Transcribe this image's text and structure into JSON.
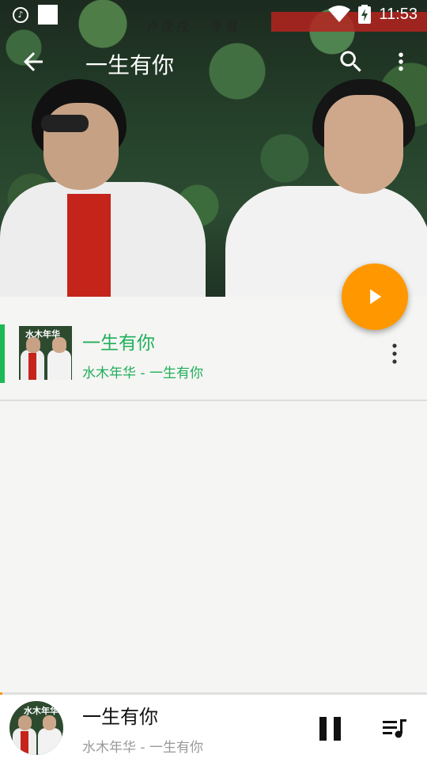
{
  "status_bar": {
    "time": "11:53",
    "icons": [
      "music-note-icon",
      "notification-square-icon",
      "wifi-icon",
      "battery-charging-icon"
    ]
  },
  "toolbar": {
    "title": "一生有你",
    "back_icon": "arrow-left-icon",
    "search_icon": "search-icon",
    "more_icon": "more-vertical-icon"
  },
  "album_art": {
    "text_line": "卢庚戌 · 李健",
    "banner_text": "一生有 你"
  },
  "fab": {
    "icon": "play-icon",
    "color": "#ff9800"
  },
  "song_list": [
    {
      "title": "一生有你",
      "subtitle": "水木年华 - 一生有你",
      "thumb_text": "水木年华",
      "active": true
    }
  ],
  "mini_player": {
    "title": "一生有你",
    "subtitle": "水木年华 - 一生有你",
    "art_text": "水木年华",
    "progress": 0.005,
    "pause_icon": "pause-icon",
    "queue_icon": "queue-music-icon"
  },
  "colors": {
    "accent": "#1faf5a",
    "fab": "#ff9800",
    "background": "#f5f5f3"
  }
}
